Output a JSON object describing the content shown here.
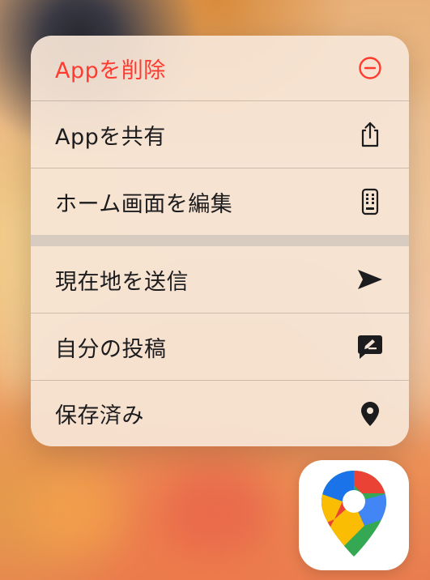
{
  "menu": {
    "items": [
      {
        "label": "Appを削除",
        "icon": "minus-circle-icon",
        "color": "#ff3b30"
      },
      {
        "label": "Appを共有",
        "icon": "share-icon"
      },
      {
        "label": "ホーム画面を編集",
        "icon": "phone-edit-icon"
      },
      {
        "label": "現在地を送信",
        "icon": "send-arrow-icon"
      },
      {
        "label": "自分の投稿",
        "icon": "compose-icon"
      },
      {
        "label": "保存済み",
        "icon": "location-pin-icon"
      }
    ]
  },
  "app": {
    "icon": "google-maps-icon"
  },
  "colors": {
    "destructive": "#ff3b30",
    "text": "#1c1c1e",
    "menu_bg": "#f6e5d6"
  }
}
